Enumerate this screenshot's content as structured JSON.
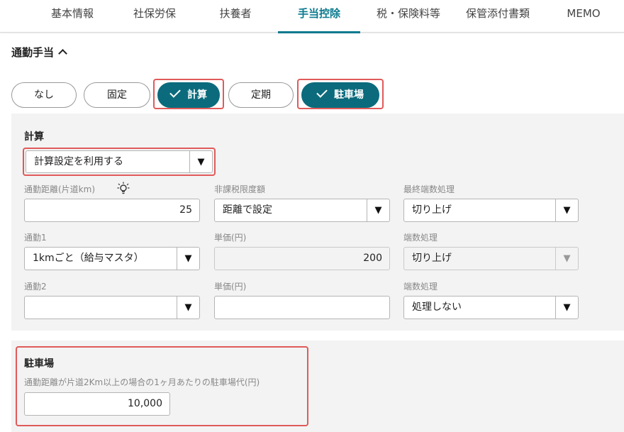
{
  "tabs": [
    {
      "label": "基本情報",
      "active": false
    },
    {
      "label": "社保労保",
      "active": false
    },
    {
      "label": "扶養者",
      "active": false
    },
    {
      "label": "手当控除",
      "active": true
    },
    {
      "label": "税・保険料等",
      "active": false
    },
    {
      "label": "保管添付書類",
      "active": false
    },
    {
      "label": "MEMO",
      "active": false
    }
  ],
  "section": {
    "title": "通勤手当"
  },
  "options": [
    {
      "label": "なし",
      "selected": false
    },
    {
      "label": "固定",
      "selected": false
    },
    {
      "label": "計算",
      "selected": true
    },
    {
      "label": "定期",
      "selected": false
    },
    {
      "label": "駐車場",
      "selected": true
    }
  ],
  "calc": {
    "title": "計算",
    "setting": {
      "value": "計算設定を利用する"
    },
    "distance": {
      "label": "通勤距離(片道km)",
      "value": "25"
    },
    "tax_free_limit": {
      "label": "非課税限度額",
      "value": "距離で設定"
    },
    "final_rounding": {
      "label": "最終端数処理",
      "value": "切り上げ"
    },
    "commute1": {
      "label": "通勤1",
      "value": "1kmごと（給与マスタ）"
    },
    "unit_price1": {
      "label": "単価(円)",
      "value": "200"
    },
    "rounding1": {
      "label": "端数処理",
      "value": "切り上げ"
    },
    "commute2": {
      "label": "通勤2",
      "value": ""
    },
    "unit_price2": {
      "label": "単価(円)",
      "value": ""
    },
    "rounding2": {
      "label": "端数処理",
      "value": "処理しない"
    }
  },
  "parking": {
    "title": "駐車場",
    "description": "通勤距離が片道2Km以上の場合の1ヶ月あたりの駐車場代(円)",
    "value": "10,000"
  },
  "dropdown_arrow": "▼",
  "colors": {
    "accent": "#0b7a8f",
    "pill_selected": "#0b6b7c",
    "highlight": "#e05a5a",
    "panel_bg": "#f3f3f3"
  }
}
